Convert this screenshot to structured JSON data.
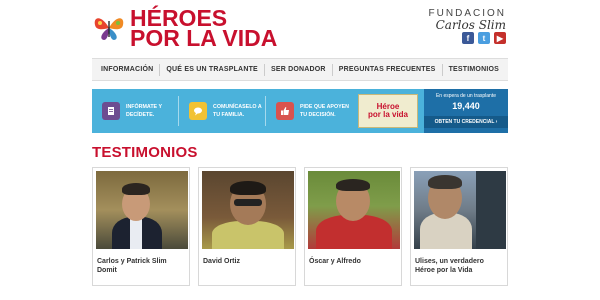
{
  "header": {
    "logo_line1": "HÉROES",
    "logo_line2": "POR LA VIDA",
    "foundation_top": "FUNDACION",
    "foundation_bottom": "Carlos Slim",
    "social": {
      "facebook": "f",
      "twitter": "t",
      "youtube": "▶"
    }
  },
  "nav": {
    "items": [
      "INFORMACIÓN",
      "QUÉ ES UN TRASPLANTE",
      "SER DONADOR",
      "PREGUNTAS FRECUENTES",
      "TESTIMONIOS"
    ]
  },
  "banner": {
    "items": [
      {
        "text": "INFÓRMATE Y DECÍDETE.",
        "icon": "info-icon"
      },
      {
        "text": "COMUNÍCASELO A TU FAMILIA.",
        "icon": "chat-icon"
      },
      {
        "text": "PIDE QUE APOYEN TU DECISIÓN.",
        "icon": "thumbs-up-icon"
      }
    ],
    "logo_line1": "Héroe",
    "logo_line2": "por la vida",
    "counter_label": "En espera de un trasplante",
    "counter_value": "19,440",
    "counter_link": "OBTEN TU CREDENCIAL ›"
  },
  "testimonios": {
    "title": "TESTIMONIOS",
    "cards": [
      {
        "label": "Carlos y Patrick Slim Domit"
      },
      {
        "label": "David Ortiz"
      },
      {
        "label": "Óscar y Alfredo"
      },
      {
        "label": "Ulises, un verdadero Héroe por la Vida"
      }
    ]
  },
  "colors": {
    "brand_red": "#c8102e",
    "banner_blue": "#4bb2db",
    "counter_blue": "#1e6fa7"
  }
}
